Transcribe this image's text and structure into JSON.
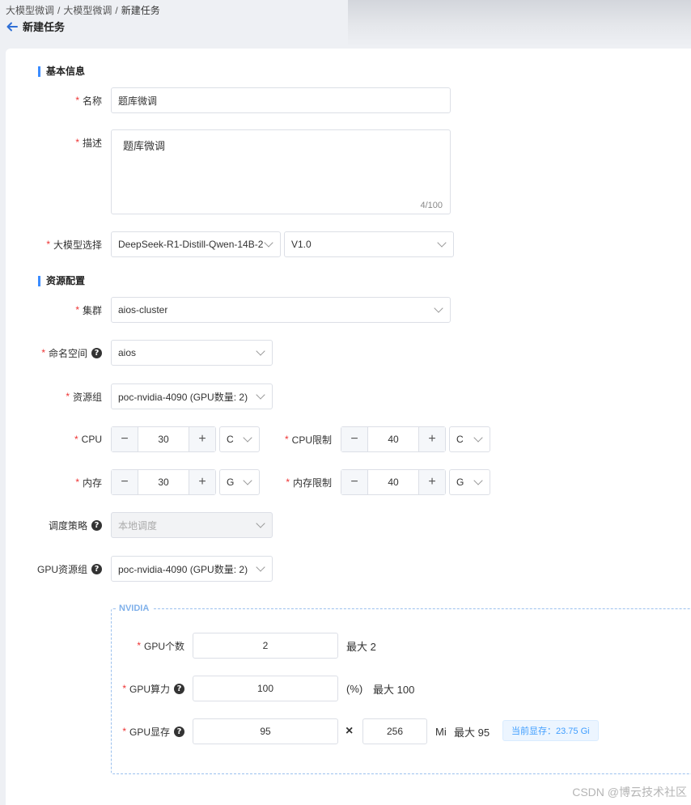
{
  "breadcrumb": {
    "crumb1": "大模型微调",
    "crumb2": "大模型微调",
    "current": "新建任务",
    "sep": "/"
  },
  "page": {
    "title": "新建任务"
  },
  "sections": {
    "basic": "基本信息",
    "resource": "资源配置"
  },
  "required_mark": "*",
  "help_glyph": "?",
  "basic": {
    "name_label": "名称",
    "name_value": "题库微调",
    "desc_label": "描述",
    "desc_value": "题库微调",
    "desc_count": "4/100",
    "model_label": "大模型选择",
    "model_value": "DeepSeek-R1-Distill-Qwen-14B-2",
    "version_value": "V1.0"
  },
  "resource": {
    "cluster_label": "集群",
    "cluster_value": "aios-cluster",
    "namespace_label": "命名空间",
    "namespace_value": "aios",
    "group_label": "资源组",
    "group_value": "poc-nvidia-4090 (GPU数量: 2)",
    "cpu_label": "CPU",
    "cpu_value": "30",
    "cpu_unit": "C",
    "cpu_limit_label": "CPU限制",
    "cpu_limit_value": "40",
    "cpu_limit_unit": "C",
    "mem_label": "内存",
    "mem_value": "30",
    "mem_unit": "G",
    "mem_limit_label": "内存限制",
    "mem_limit_value": "40",
    "mem_limit_unit": "G",
    "schedule_label": "调度策略",
    "schedule_value": "本地调度",
    "gpu_group_label": "GPU资源组",
    "gpu_group_value": "poc-nvidia-4090 (GPU数量: 2)"
  },
  "stepper": {
    "minus": "−",
    "plus": "+"
  },
  "gpu": {
    "legend": "NVIDIA",
    "count_label": "GPU个数",
    "count_value": "2",
    "count_max": "最大 2",
    "power_label": "GPU算力",
    "power_value": "100",
    "power_unit": "(%)",
    "power_max": "最大 100",
    "mem_label": "GPU显存",
    "mem_value": "95",
    "mem_multiplier": "256",
    "mem_unit": "Mi",
    "mem_max": "最大 95",
    "times": "×",
    "current_mem": "当前显存：23.75 Gi"
  },
  "watermark": "CSDN @博云技术社区",
  "colors": {
    "accent": "#3b8cff",
    "required": "#e33333",
    "tag_text": "#409eff"
  }
}
